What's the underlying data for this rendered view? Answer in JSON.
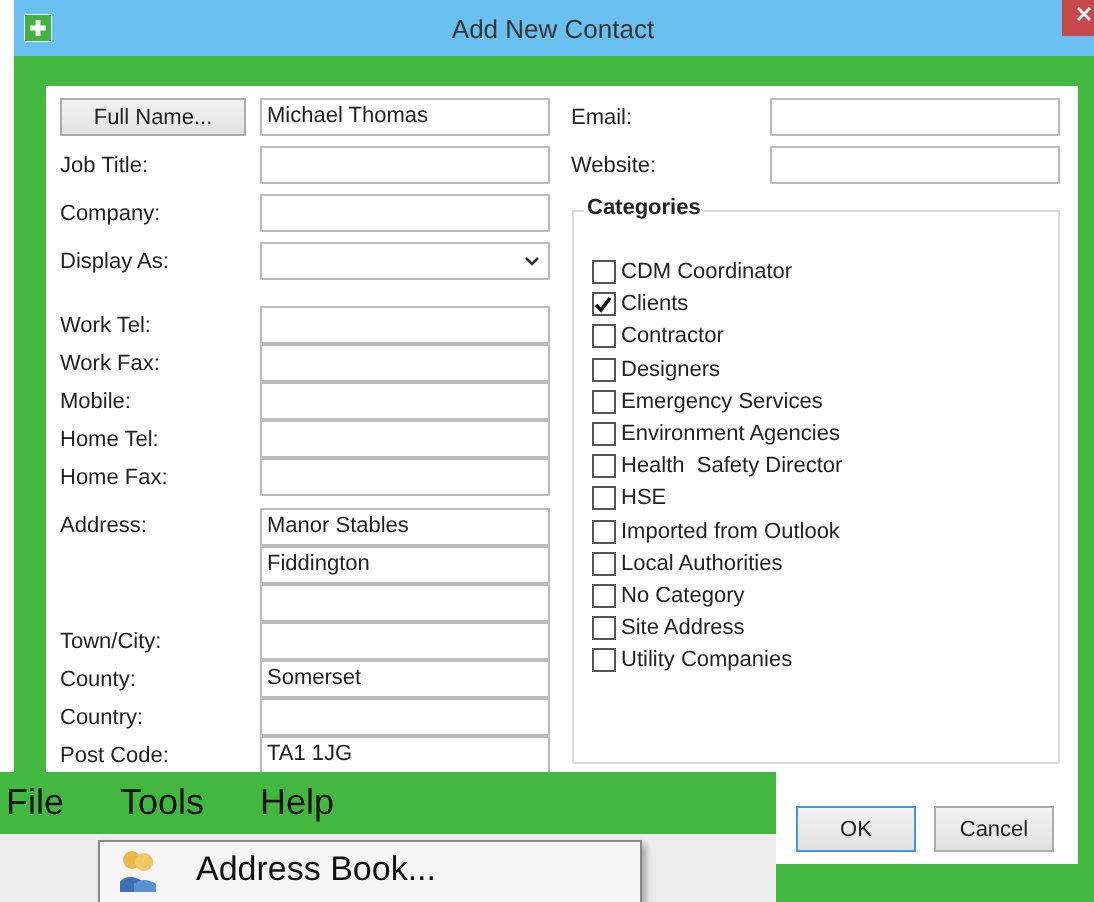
{
  "window": {
    "title": "Add New Contact"
  },
  "name": {
    "button": "Full Name...",
    "value": "Michael Thomas"
  },
  "left_fields": [
    {
      "kind": "text",
      "label": "Job Title:"
    },
    {
      "kind": "text",
      "label": "Company:"
    },
    {
      "kind": "dropdown",
      "label": "Display As:"
    }
  ],
  "phone_fields": [
    {
      "label": "Work Tel:"
    },
    {
      "label": "Work Fax:"
    },
    {
      "label": "Mobile:"
    },
    {
      "label": "Home Tel:"
    },
    {
      "label": "Home Fax:"
    }
  ],
  "address": {
    "label": "Address:",
    "lines": [
      "Manor Stables",
      "Fiddington"
    ]
  },
  "place_fields": [
    {
      "label": "Town/City:"
    },
    {
      "label": "County:",
      "value": "Somerset"
    },
    {
      "label": "Country:"
    },
    {
      "label": "Post Code:",
      "value": "TA1 1JG"
    }
  ],
  "right_fields": [
    {
      "label": "Email:"
    },
    {
      "label": "Website:"
    }
  ],
  "categories": {
    "title": "Categories",
    "items": [
      {
        "label": "CDM Coordinator",
        "checked": false
      },
      {
        "label": "Clients",
        "checked": true
      },
      {
        "label": "Contractor",
        "checked": false
      },
      {
        "label": "Designers",
        "checked": false
      },
      {
        "label": "Emergency Services",
        "checked": false
      },
      {
        "label": "Environment Agencies",
        "checked": false
      },
      {
        "label": "Health  Safety Director",
        "checked": false
      },
      {
        "label": "HSE",
        "checked": false
      },
      {
        "label": "Imported from Outlook",
        "checked": false
      },
      {
        "label": "Local Authorities",
        "checked": false
      },
      {
        "label": "No Category",
        "checked": false
      },
      {
        "label": "Site Address",
        "checked": false
      },
      {
        "label": "Utility Companies",
        "checked": false
      }
    ]
  },
  "buttons": [
    {
      "label": "OK",
      "default": true
    },
    {
      "label": "Cancel",
      "default": false
    }
  ],
  "background_app": {
    "menu": [
      "File",
      "Tools",
      "Help"
    ],
    "popup_item": "Address Book..."
  }
}
